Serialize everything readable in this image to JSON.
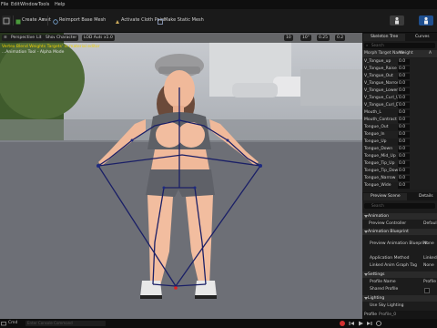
{
  "menu": {
    "items": [
      "File",
      "Edit",
      "Window",
      "Tools",
      "Help"
    ]
  },
  "toolbar": {
    "create_asset": "Create Asset",
    "reimport": "Reimport Base Mesh",
    "activate_cloth": "Activate Cloth Paint",
    "make_static": "Make Static Mesh"
  },
  "viewport": {
    "chips": [
      "Perspective",
      "Lit",
      "Show",
      "Character",
      "LOD Auto",
      "x1.0"
    ],
    "right_chips": [
      "10",
      "10°",
      "0.25",
      "0.2"
    ],
    "overlay_line1": "Vertex Blend Weights Targets' in material editor",
    "overlay_line2": "...Animation Tool - Alpha Mode",
    "background": "#6d6f76",
    "grass_color": "#3f5b2c"
  },
  "right_panel": {
    "tabs": [
      "Skeleton Tree",
      "Curves"
    ],
    "search_label": "Search",
    "headers": [
      "Morph Target Name",
      "Weight",
      "A"
    ],
    "targets": [
      {
        "name": "V_Tongue_up",
        "value": "0.0"
      },
      {
        "name": "V_Tongue_Raise",
        "value": "0.0"
      },
      {
        "name": "V_Tongue_Out",
        "value": "0.0"
      },
      {
        "name": "V_Tongue_Narrow",
        "value": "0.0"
      },
      {
        "name": "V_Tongue_Lower",
        "value": "0.0"
      },
      {
        "name": "V_Tongue_Curl_U",
        "value": "0.0"
      },
      {
        "name": "V_Tongue_Curl_D",
        "value": "0.0"
      },
      {
        "name": "Mouth_L",
        "value": "0.0"
      },
      {
        "name": "Mouth_Contract",
        "value": "0.0"
      },
      {
        "name": "Tongue_Out",
        "value": "0.0"
      },
      {
        "name": "Tongue_In",
        "value": "0.0"
      },
      {
        "name": "Tongue_Up",
        "value": "0.0"
      },
      {
        "name": "Tongue_Down",
        "value": "0.0"
      },
      {
        "name": "Tongue_Mid_Up",
        "value": "0.0"
      },
      {
        "name": "Tongue_Tip_Up",
        "value": "0.0"
      },
      {
        "name": "Tongue_Tip_Down",
        "value": "0.0"
      },
      {
        "name": "Tongue_Narrow",
        "value": "0.0"
      },
      {
        "name": "Tongue_Wide",
        "value": "0.0"
      }
    ],
    "lower_tabs": [
      "Preview Scene",
      "Details"
    ],
    "sections": {
      "animation": "Animation",
      "animation_blueprint": "Animation Blueprint",
      "settings": "Settings",
      "lighting": "Lighting"
    },
    "details": {
      "preview_controller": "Preview Controller",
      "preview_controller_value": "Defaul",
      "preview_anim_blueprint": "Preview Animation Blueprint",
      "preview_anim_blueprint_value": "None",
      "application_method": "Application Method",
      "application_method_value": "Linked",
      "linked_anim_graph": "Linked Anim Graph Tag",
      "linked_anim_graph_value": "None",
      "profile_name": "Profile Name",
      "profile_name_value": "Profile",
      "shared_profile": "Shared Profile",
      "use_sky_lighting": "Use Sky Lighting"
    },
    "status_label": "Profile",
    "status_value": "Profile_0"
  },
  "bottom": {
    "content_drawer": "Content Drawer",
    "cmd": "Cmd",
    "console_placeholder": "Enter Console Command"
  }
}
